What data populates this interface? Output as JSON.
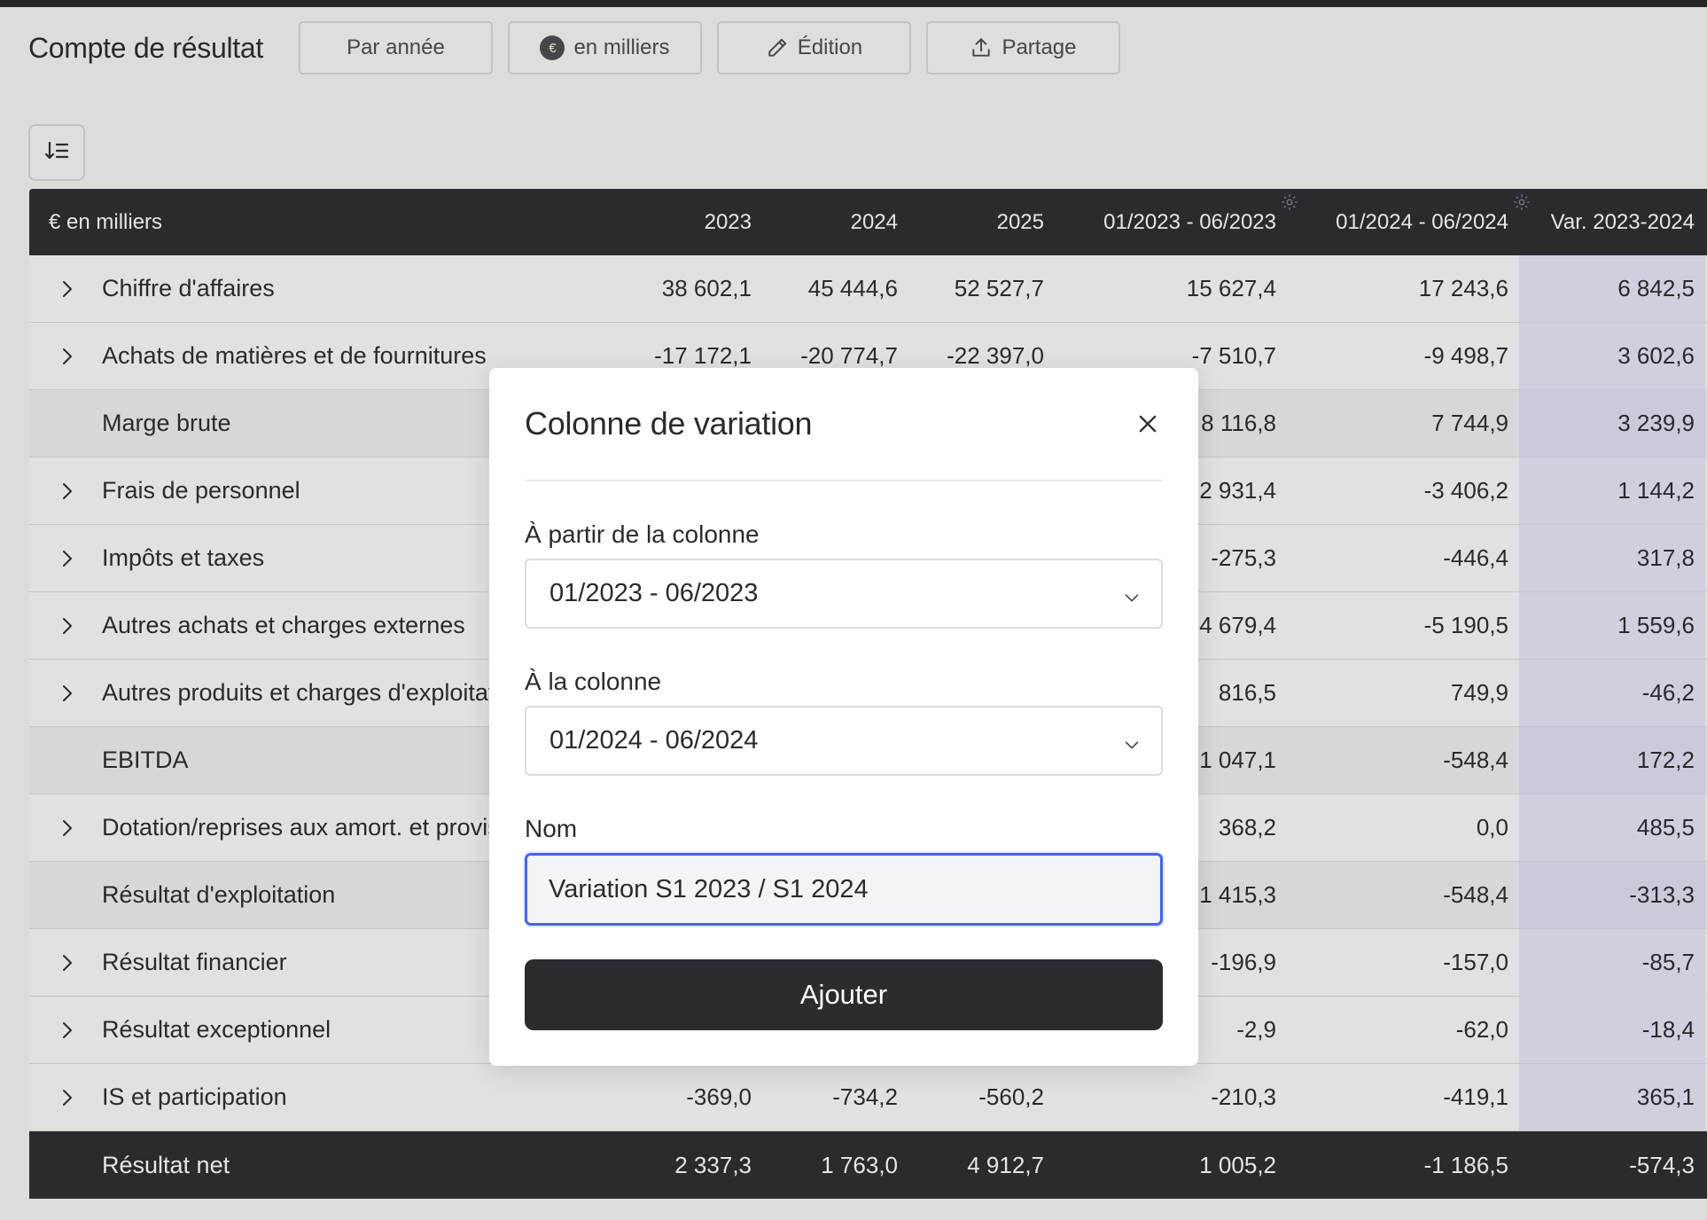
{
  "toolbar": {
    "title": "Compte de résultat",
    "by_year_label": "Par année",
    "currency_label": "en milliers",
    "currency_symbol": "€",
    "edit_label": "Édition",
    "share_label": "Partage"
  },
  "table": {
    "header": {
      "label": "€ en milliers",
      "columns": [
        "2023",
        "2024",
        "2025",
        "01/2023 - 06/2023",
        "01/2024 - 06/2024",
        "Var. 2023-2024"
      ]
    },
    "rows": [
      {
        "label": "Chiffre d'affaires",
        "expandable": true,
        "subtotal": false,
        "values": [
          "38 602,1",
          "45 444,6",
          "52 527,7",
          "15 627,4",
          "17 243,6",
          "6 842,5"
        ]
      },
      {
        "label": "Achats de matières et de fournitures",
        "expandable": true,
        "subtotal": false,
        "values": [
          "-17 172,1",
          "-20 774,7",
          "-22 397,0",
          "-7 510,7",
          "-9 498,7",
          "3 602,6"
        ]
      },
      {
        "label": "Marge brute",
        "expandable": false,
        "subtotal": true,
        "values": [
          "",
          "",
          "",
          "8 116,8",
          "7 744,9",
          "3 239,9"
        ]
      },
      {
        "label": "Frais de personnel",
        "expandable": true,
        "subtotal": false,
        "values": [
          "",
          "",
          "",
          "2 931,4",
          "-3 406,2",
          "1 144,2"
        ]
      },
      {
        "label": "Impôts et taxes",
        "expandable": true,
        "subtotal": false,
        "values": [
          "",
          "",
          "",
          "-275,3",
          "-446,4",
          "317,8"
        ]
      },
      {
        "label": "Autres achats et charges externes",
        "expandable": true,
        "subtotal": false,
        "values": [
          "",
          "",
          "",
          "4 679,4",
          "-5 190,5",
          "1 559,6"
        ]
      },
      {
        "label": "Autres produits et charges d'exploitation",
        "expandable": true,
        "subtotal": false,
        "values": [
          "",
          "",
          "",
          "816,5",
          "749,9",
          "-46,2"
        ]
      },
      {
        "label": "EBITDA",
        "expandable": false,
        "subtotal": true,
        "values": [
          "",
          "",
          "",
          "1 047,1",
          "-548,4",
          "172,2"
        ]
      },
      {
        "label": "Dotation/reprises aux amort. et provisions",
        "expandable": true,
        "subtotal": false,
        "values": [
          "",
          "",
          "",
          "368,2",
          "0,0",
          "485,5"
        ]
      },
      {
        "label": "Résultat d'exploitation",
        "expandable": false,
        "subtotal": true,
        "values": [
          "",
          "",
          "",
          "1 415,3",
          "-548,4",
          "-313,3"
        ]
      },
      {
        "label": "Résultat financier",
        "expandable": true,
        "subtotal": false,
        "values": [
          "",
          "",
          "",
          "-196,9",
          "-157,0",
          "-85,7"
        ]
      },
      {
        "label": "Résultat exceptionnel",
        "expandable": true,
        "subtotal": false,
        "values": [
          "",
          "",
          "",
          "-2,9",
          "-62,0",
          "-18,4"
        ]
      },
      {
        "label": "IS et participation",
        "expandable": true,
        "subtotal": false,
        "values": [
          "-369,0",
          "-734,2",
          "-560,2",
          "-210,3",
          "-419,1",
          "365,1"
        ]
      }
    ],
    "total": {
      "label": "Résultat net",
      "values": [
        "2 337,3",
        "1 763,0",
        "4 912,7",
        "1 005,2",
        "-1 186,5",
        "-574,3"
      ]
    }
  },
  "modal": {
    "title": "Colonne de variation",
    "from_label": "À partir de la colonne",
    "from_value": "01/2023 - 06/2023",
    "to_label": "À la colonne",
    "to_value": "01/2024 - 06/2024",
    "name_label": "Nom",
    "name_value": "Variation S1 2023 / S1 2024",
    "submit_label": "Ajouter"
  }
}
